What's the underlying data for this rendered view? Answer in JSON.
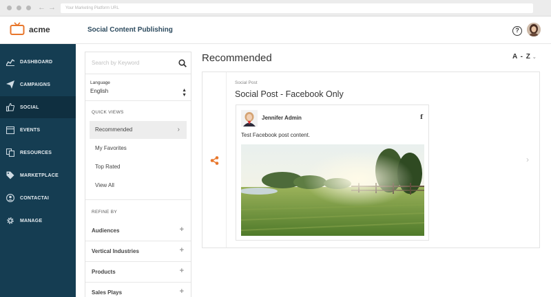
{
  "browser": {
    "url_placeholder": "Your Marketing Platform URL"
  },
  "header": {
    "brand": "acme",
    "app_title": "Social Content Publishing",
    "help_label": "?"
  },
  "sidebar": {
    "items": [
      {
        "label": "DASHBOARD",
        "icon": "chart-icon",
        "active": false
      },
      {
        "label": "CAMPAIGNS",
        "icon": "paper-plane-icon",
        "active": false
      },
      {
        "label": "SOCIAL",
        "icon": "thumbs-up-icon",
        "active": true
      },
      {
        "label": "EVENTS",
        "icon": "calendar-icon",
        "active": false
      },
      {
        "label": "RESOURCES",
        "icon": "files-icon",
        "active": false
      },
      {
        "label": "MARKETPLACE",
        "icon": "tag-icon",
        "active": false
      },
      {
        "label": "CONTACTAI",
        "icon": "person-icon",
        "active": false
      },
      {
        "label": "MANAGE",
        "icon": "gear-icon",
        "active": false
      }
    ]
  },
  "filters": {
    "search_placeholder": "Search by Keyword",
    "language_label": "Language",
    "language_value": "English",
    "quick_views_heading": "QUICK VIEWS",
    "quick_views": [
      {
        "label": "Recommended",
        "selected": true
      },
      {
        "label": "My Favorites",
        "selected": false
      },
      {
        "label": "Top Rated",
        "selected": false
      },
      {
        "label": "View All",
        "selected": false
      }
    ],
    "refine_heading": "REFINE BY",
    "refine": [
      {
        "label": "Audiences"
      },
      {
        "label": "Vertical Industries"
      },
      {
        "label": "Products"
      },
      {
        "label": "Sales Plays"
      }
    ]
  },
  "main": {
    "title": "Recommended",
    "sort_label": "A - Z",
    "card": {
      "type": "Social Post",
      "title": "Social Post - Facebook Only",
      "post": {
        "author": "Jennifer Admin",
        "network": "f",
        "text": "Test Facebook post content."
      }
    }
  },
  "colors": {
    "sidebar_bg": "#153d52",
    "sidebar_active_bg": "#0f2f40",
    "brand_accent": "#e8762b",
    "title_blue": "#2c4a5e"
  }
}
